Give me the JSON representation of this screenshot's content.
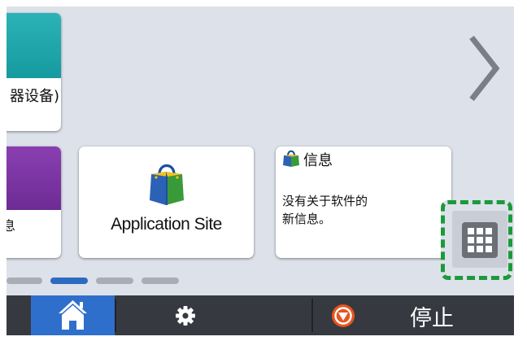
{
  "tiles": {
    "left_top": {
      "label": "器设备)"
    },
    "left_bottom": {
      "label": "息"
    },
    "application_site": {
      "label": "Application Site"
    },
    "info": {
      "title": "信息",
      "message_line1": "没有关于软件的",
      "message_line2": "新信息。"
    }
  },
  "pager": {
    "count": 4,
    "active_index": 1
  },
  "bottom_bar": {
    "stop_label": "停止"
  },
  "colors": {
    "screen_bg": "#dde1e9",
    "teal": "#1aa3a8",
    "purple": "#7b34a3",
    "home_blue": "#2e6fcc",
    "bar": "#363a40",
    "highlight_green": "#1b9a3c",
    "stop_orange": "#e8541d"
  },
  "icons": {
    "next": "chevron-right-icon",
    "apps": "app-grid-icon",
    "home": "home-icon",
    "settings": "gear-icon",
    "stop": "stop-icon",
    "bag": "shopping-bag-icon"
  }
}
